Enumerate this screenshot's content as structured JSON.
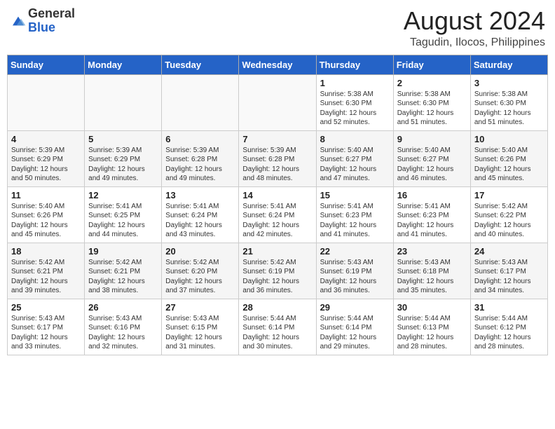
{
  "header": {
    "logo_general": "General",
    "logo_blue": "Blue",
    "month_title": "August 2024",
    "location": "Tagudin, Ilocos, Philippines"
  },
  "days_of_week": [
    "Sunday",
    "Monday",
    "Tuesday",
    "Wednesday",
    "Thursday",
    "Friday",
    "Saturday"
  ],
  "weeks": [
    [
      {
        "day": "",
        "info": ""
      },
      {
        "day": "",
        "info": ""
      },
      {
        "day": "",
        "info": ""
      },
      {
        "day": "",
        "info": ""
      },
      {
        "day": "1",
        "info": "Sunrise: 5:38 AM\nSunset: 6:30 PM\nDaylight: 12 hours\nand 52 minutes."
      },
      {
        "day": "2",
        "info": "Sunrise: 5:38 AM\nSunset: 6:30 PM\nDaylight: 12 hours\nand 51 minutes."
      },
      {
        "day": "3",
        "info": "Sunrise: 5:38 AM\nSunset: 6:30 PM\nDaylight: 12 hours\nand 51 minutes."
      }
    ],
    [
      {
        "day": "4",
        "info": "Sunrise: 5:39 AM\nSunset: 6:29 PM\nDaylight: 12 hours\nand 50 minutes."
      },
      {
        "day": "5",
        "info": "Sunrise: 5:39 AM\nSunset: 6:29 PM\nDaylight: 12 hours\nand 49 minutes."
      },
      {
        "day": "6",
        "info": "Sunrise: 5:39 AM\nSunset: 6:28 PM\nDaylight: 12 hours\nand 49 minutes."
      },
      {
        "day": "7",
        "info": "Sunrise: 5:39 AM\nSunset: 6:28 PM\nDaylight: 12 hours\nand 48 minutes."
      },
      {
        "day": "8",
        "info": "Sunrise: 5:40 AM\nSunset: 6:27 PM\nDaylight: 12 hours\nand 47 minutes."
      },
      {
        "day": "9",
        "info": "Sunrise: 5:40 AM\nSunset: 6:27 PM\nDaylight: 12 hours\nand 46 minutes."
      },
      {
        "day": "10",
        "info": "Sunrise: 5:40 AM\nSunset: 6:26 PM\nDaylight: 12 hours\nand 45 minutes."
      }
    ],
    [
      {
        "day": "11",
        "info": "Sunrise: 5:40 AM\nSunset: 6:26 PM\nDaylight: 12 hours\nand 45 minutes."
      },
      {
        "day": "12",
        "info": "Sunrise: 5:41 AM\nSunset: 6:25 PM\nDaylight: 12 hours\nand 44 minutes."
      },
      {
        "day": "13",
        "info": "Sunrise: 5:41 AM\nSunset: 6:24 PM\nDaylight: 12 hours\nand 43 minutes."
      },
      {
        "day": "14",
        "info": "Sunrise: 5:41 AM\nSunset: 6:24 PM\nDaylight: 12 hours\nand 42 minutes."
      },
      {
        "day": "15",
        "info": "Sunrise: 5:41 AM\nSunset: 6:23 PM\nDaylight: 12 hours\nand 41 minutes."
      },
      {
        "day": "16",
        "info": "Sunrise: 5:41 AM\nSunset: 6:23 PM\nDaylight: 12 hours\nand 41 minutes."
      },
      {
        "day": "17",
        "info": "Sunrise: 5:42 AM\nSunset: 6:22 PM\nDaylight: 12 hours\nand 40 minutes."
      }
    ],
    [
      {
        "day": "18",
        "info": "Sunrise: 5:42 AM\nSunset: 6:21 PM\nDaylight: 12 hours\nand 39 minutes."
      },
      {
        "day": "19",
        "info": "Sunrise: 5:42 AM\nSunset: 6:21 PM\nDaylight: 12 hours\nand 38 minutes."
      },
      {
        "day": "20",
        "info": "Sunrise: 5:42 AM\nSunset: 6:20 PM\nDaylight: 12 hours\nand 37 minutes."
      },
      {
        "day": "21",
        "info": "Sunrise: 5:42 AM\nSunset: 6:19 PM\nDaylight: 12 hours\nand 36 minutes."
      },
      {
        "day": "22",
        "info": "Sunrise: 5:43 AM\nSunset: 6:19 PM\nDaylight: 12 hours\nand 36 minutes."
      },
      {
        "day": "23",
        "info": "Sunrise: 5:43 AM\nSunset: 6:18 PM\nDaylight: 12 hours\nand 35 minutes."
      },
      {
        "day": "24",
        "info": "Sunrise: 5:43 AM\nSunset: 6:17 PM\nDaylight: 12 hours\nand 34 minutes."
      }
    ],
    [
      {
        "day": "25",
        "info": "Sunrise: 5:43 AM\nSunset: 6:17 PM\nDaylight: 12 hours\nand 33 minutes."
      },
      {
        "day": "26",
        "info": "Sunrise: 5:43 AM\nSunset: 6:16 PM\nDaylight: 12 hours\nand 32 minutes."
      },
      {
        "day": "27",
        "info": "Sunrise: 5:43 AM\nSunset: 6:15 PM\nDaylight: 12 hours\nand 31 minutes."
      },
      {
        "day": "28",
        "info": "Sunrise: 5:44 AM\nSunset: 6:14 PM\nDaylight: 12 hours\nand 30 minutes."
      },
      {
        "day": "29",
        "info": "Sunrise: 5:44 AM\nSunset: 6:14 PM\nDaylight: 12 hours\nand 29 minutes."
      },
      {
        "day": "30",
        "info": "Sunrise: 5:44 AM\nSunset: 6:13 PM\nDaylight: 12 hours\nand 28 minutes."
      },
      {
        "day": "31",
        "info": "Sunrise: 5:44 AM\nSunset: 6:12 PM\nDaylight: 12 hours\nand 28 minutes."
      }
    ]
  ]
}
